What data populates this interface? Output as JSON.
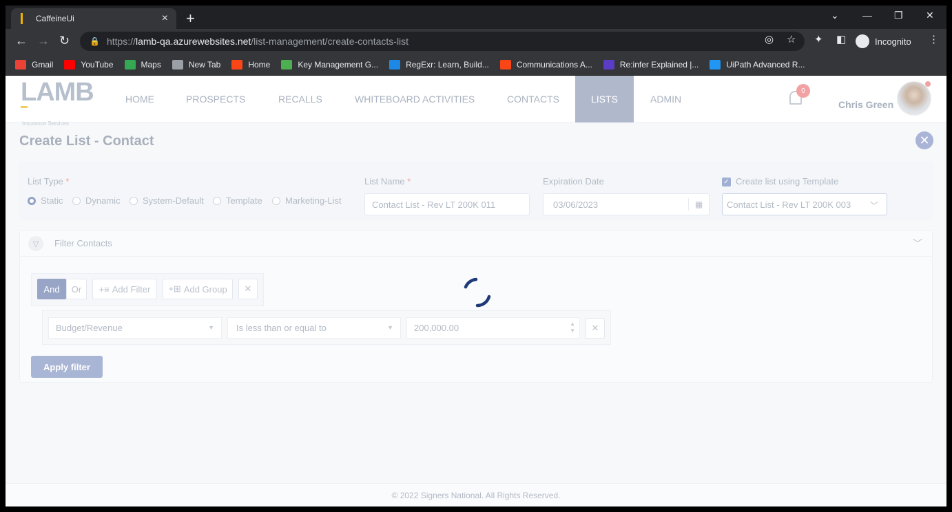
{
  "browser": {
    "tab_title": "CaffeineUi",
    "url_prefix": "https://",
    "url_host": "lamb-qa.azurewebsites.net",
    "url_path": "/list-management/create-contacts-list",
    "incognito_label": "Incognito",
    "bookmarks": [
      {
        "label": "Gmail",
        "color": "#ea4335"
      },
      {
        "label": "YouTube",
        "color": "#ff0000"
      },
      {
        "label": "Maps",
        "color": "#34a853"
      },
      {
        "label": "New Tab",
        "color": "#9aa0a6"
      },
      {
        "label": "Home",
        "color": "#fa4616"
      },
      {
        "label": "Key Management G...",
        "color": "#4caf50"
      },
      {
        "label": "RegExr: Learn, Build...",
        "color": "#1e88e5"
      },
      {
        "label": "Communications A...",
        "color": "#fa4616"
      },
      {
        "label": "Re:infer Explained |...",
        "color": "#5b3cc4"
      },
      {
        "label": "UiPath Advanced R...",
        "color": "#2196f3"
      }
    ]
  },
  "app": {
    "logo_text": "LAMB",
    "logo_sub": "Insurance Services",
    "nav": [
      "HOME",
      "PROSPECTS",
      "RECALLS",
      "WHITEBOARD ACTIVITIES",
      "CONTACTS",
      "LISTS",
      "ADMIN"
    ],
    "notification_count": "0",
    "user_name": "Chris Green"
  },
  "page": {
    "title": "Create List - Contact",
    "list_type_label": "List Type",
    "list_types": [
      "Static",
      "Dynamic",
      "System-Default",
      "Template",
      "Marketing-List"
    ],
    "selected_list_type": "Static",
    "list_name_label": "List Name",
    "list_name_value": "Contact List - Rev LT 200K 011",
    "expiration_label": "Expiration Date",
    "expiration_value": "03/06/2023",
    "template_checkbox_label": "Create list using Template",
    "template_value": "Contact List - Rev LT 200K 003",
    "required_mark": "*"
  },
  "filter": {
    "title": "Filter Contacts",
    "and_label": "And",
    "or_label": "Or",
    "add_filter_label": "Add Filter",
    "add_group_label": "Add Group",
    "field_value": "Budget/Revenue",
    "operator_value": "Is less than or equal to",
    "amount_value": "200,000.00",
    "apply_label": "Apply filter"
  },
  "footer": {
    "text": "© 2022 Signers National. All Rights Reserved."
  }
}
